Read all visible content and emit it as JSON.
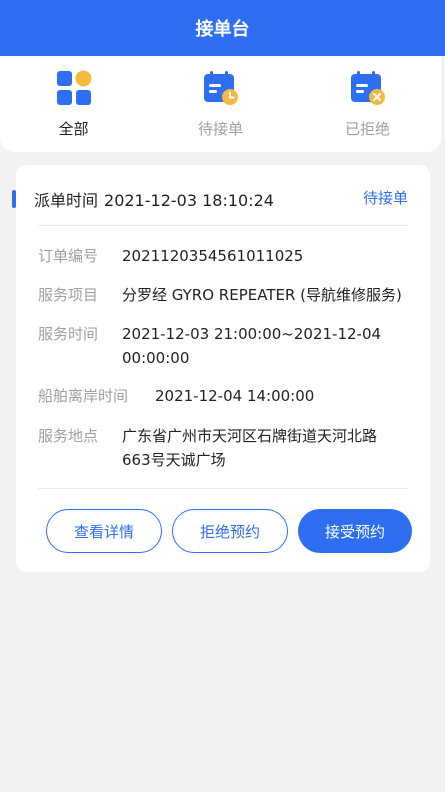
{
  "header": {
    "title": "接单台"
  },
  "tabs": [
    {
      "label": "全部",
      "icon": "grid-icon",
      "active": true
    },
    {
      "label": "待接单",
      "icon": "calendar-clock-icon",
      "active": false
    },
    {
      "label": "已拒绝",
      "icon": "calendar-reject-icon",
      "active": false
    }
  ],
  "order": {
    "dispatch_label": "派单时间",
    "dispatch_time": "2021-12-03 18:10:24",
    "status": "待接单",
    "fields": {
      "order_no": {
        "label": "订单编号",
        "value": "2021120354561011025"
      },
      "service_item": {
        "label": "服务项目",
        "value": "分罗经 GYRO REPEATER (导航维修服务)"
      },
      "service_time": {
        "label": "服务时间",
        "line1": "2021-12-03 21:00:00~2021-12-04",
        "line2": "00:00:00"
      },
      "departure_time": {
        "label": "船舶离岸时间",
        "value": "2021-12-04 14:00:00"
      },
      "service_address": {
        "label": "服务地点",
        "line1": "广东省广州市天河区石牌街道天河北路",
        "line2": "663号天诚广场"
      }
    },
    "actions": {
      "view": "查看详情",
      "reject": "拒绝预约",
      "accept": "接受预约"
    }
  },
  "colors": {
    "accent": "#2d6ff0",
    "icon_orange": "#f5b942",
    "background": "#f2f2f2"
  }
}
